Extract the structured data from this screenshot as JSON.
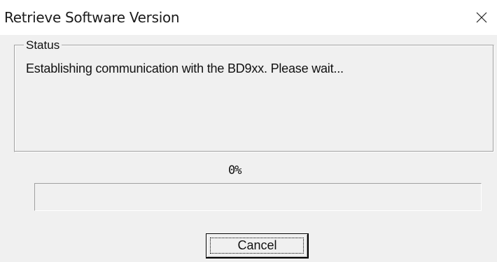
{
  "window": {
    "title": "Retrieve Software Version",
    "close_icon": "close-icon"
  },
  "status_group": {
    "label": "Status",
    "message": "Establishing communication with the BD9xx. Please wait..."
  },
  "progress": {
    "percent_text": "0%",
    "value": 0,
    "fill_color": "#06b025"
  },
  "buttons": {
    "cancel_label": "Cancel"
  }
}
